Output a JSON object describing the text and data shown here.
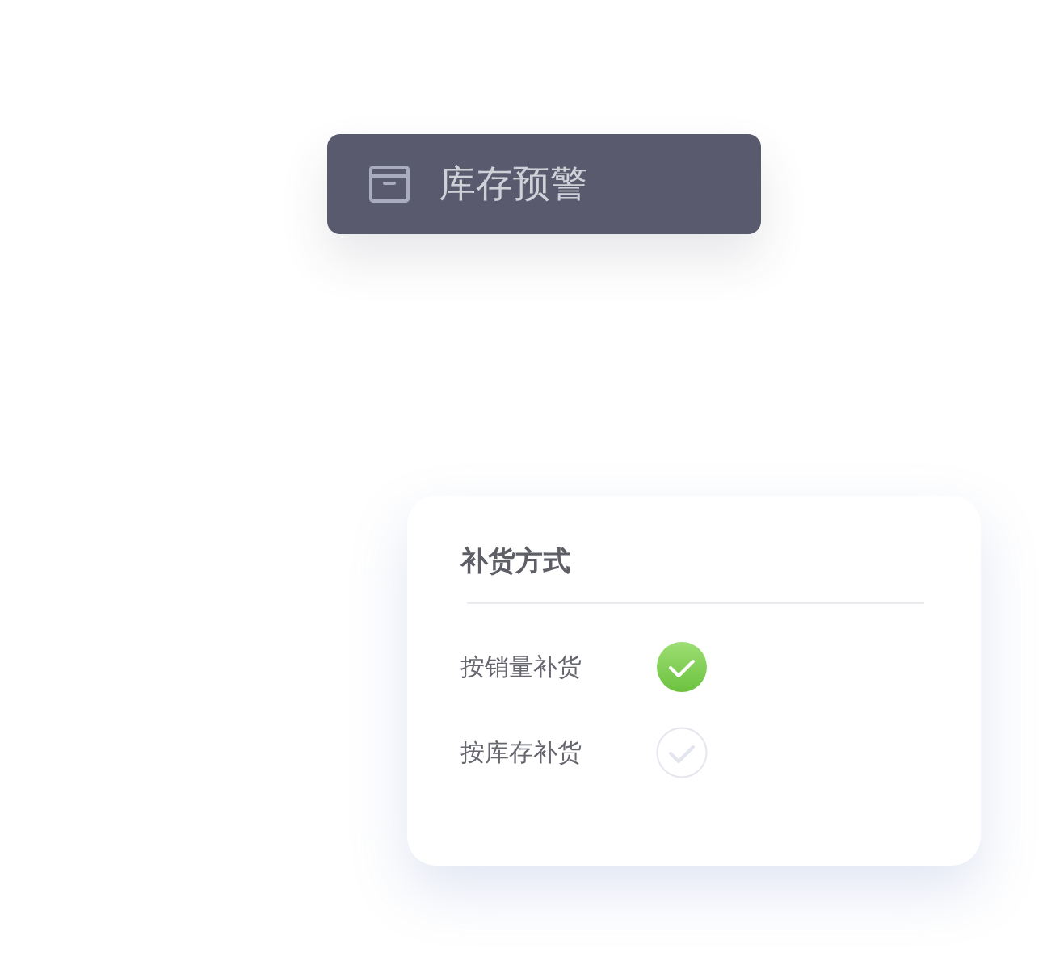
{
  "menu_item": {
    "label": "库存预警",
    "selected": true
  },
  "restock_panel": {
    "title": "补货方式",
    "options": [
      {
        "label": "按销量补货",
        "selected": true
      },
      {
        "label": "按库存补货",
        "selected": false
      }
    ]
  }
}
